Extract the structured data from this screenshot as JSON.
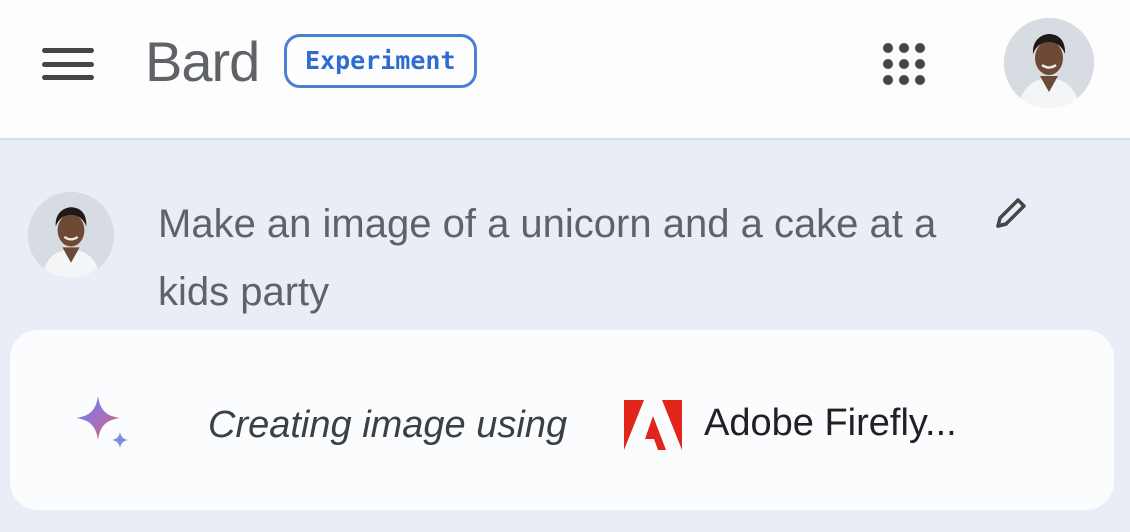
{
  "header": {
    "brand": "Bard",
    "badge": "Experiment",
    "menu_icon": "hamburger-menu-icon",
    "apps_icon": "apps-grid-icon",
    "avatar_icon": "user-avatar"
  },
  "prompt": {
    "text": "Make an image of a unicorn and a cake at a kids party",
    "edit_icon": "pencil-icon"
  },
  "response": {
    "status": "Creating image using",
    "provider": "Adobe Firefly...",
    "sparkle_icon": "bard-sparkle-icon",
    "provider_logo": "adobe-logo-icon"
  },
  "colors": {
    "accent": "#2f6bd0",
    "adobe_red": "#e1251b",
    "background": "#e9edf5"
  }
}
